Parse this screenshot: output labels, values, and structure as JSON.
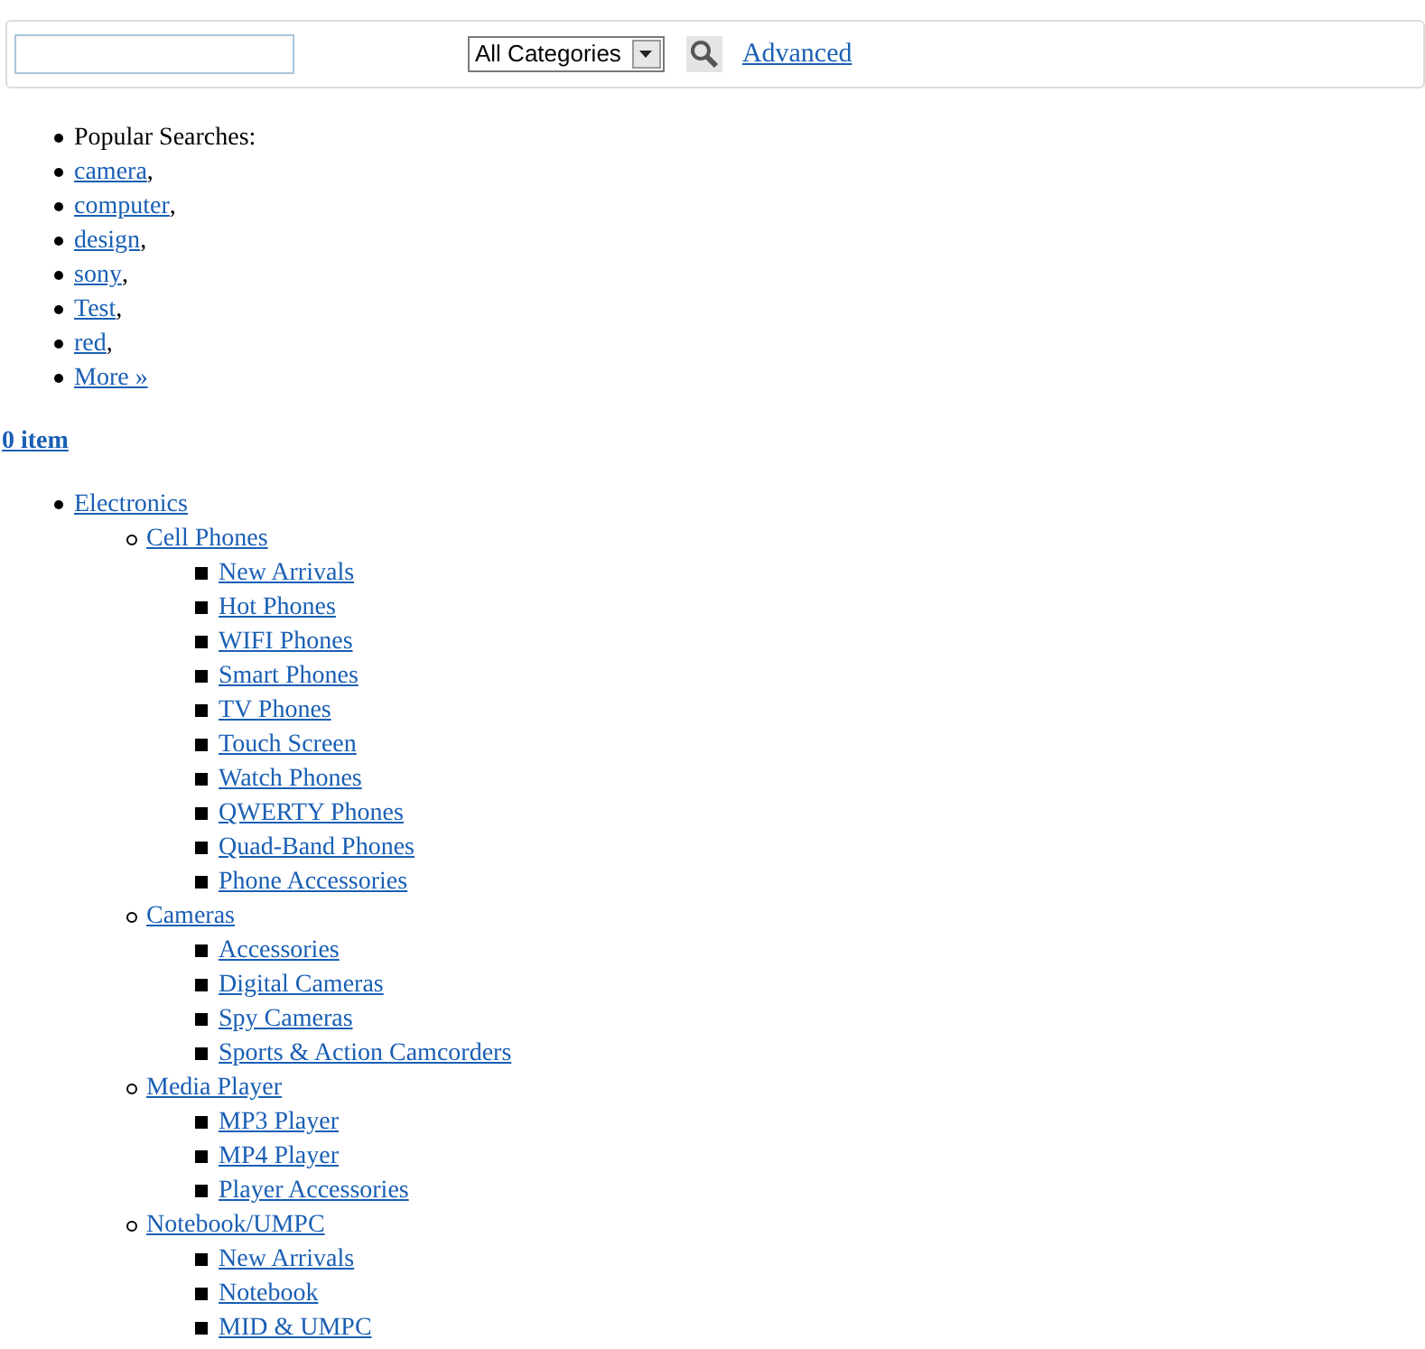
{
  "search_bar": {
    "category_select": {
      "value": "All Categories"
    },
    "advanced_link": "Advanced"
  },
  "popular_searches": {
    "label": "Popular Searches:",
    "items": [
      {
        "text": "camera",
        "separator": ","
      },
      {
        "text": "computer",
        "separator": ","
      },
      {
        "text": "design",
        "separator": ","
      },
      {
        "text": "sony",
        "separator": ","
      },
      {
        "text": "Test",
        "separator": ","
      },
      {
        "text": "red",
        "separator": ","
      },
      {
        "text": "More »"
      }
    ]
  },
  "cart_link": "0 item",
  "categories": [
    {
      "label": "Electronics",
      "children": [
        {
          "label": "Cell Phones",
          "children": [
            {
              "label": "New Arrivals"
            },
            {
              "label": "Hot Phones"
            },
            {
              "label": "WIFI Phones"
            },
            {
              "label": "Smart Phones"
            },
            {
              "label": "TV Phones"
            },
            {
              "label": "Touch Screen"
            },
            {
              "label": "Watch Phones"
            },
            {
              "label": "QWERTY Phones"
            },
            {
              "label": "Quad-Band Phones"
            },
            {
              "label": "Phone Accessories"
            }
          ]
        },
        {
          "label": "Cameras",
          "children": [
            {
              "label": "Accessories"
            },
            {
              "label": "Digital Cameras"
            },
            {
              "label": "Spy Cameras"
            },
            {
              "label": "Sports & Action Camcorders"
            }
          ]
        },
        {
          "label": "Media Player",
          "children": [
            {
              "label": "MP3 Player"
            },
            {
              "label": "MP4 Player"
            },
            {
              "label": "Player Accessories"
            }
          ]
        },
        {
          "label": "Notebook/UMPC",
          "children": [
            {
              "label": "New Arrivals"
            },
            {
              "label": "Notebook"
            },
            {
              "label": "MID & UMPC"
            }
          ]
        }
      ]
    }
  ]
}
